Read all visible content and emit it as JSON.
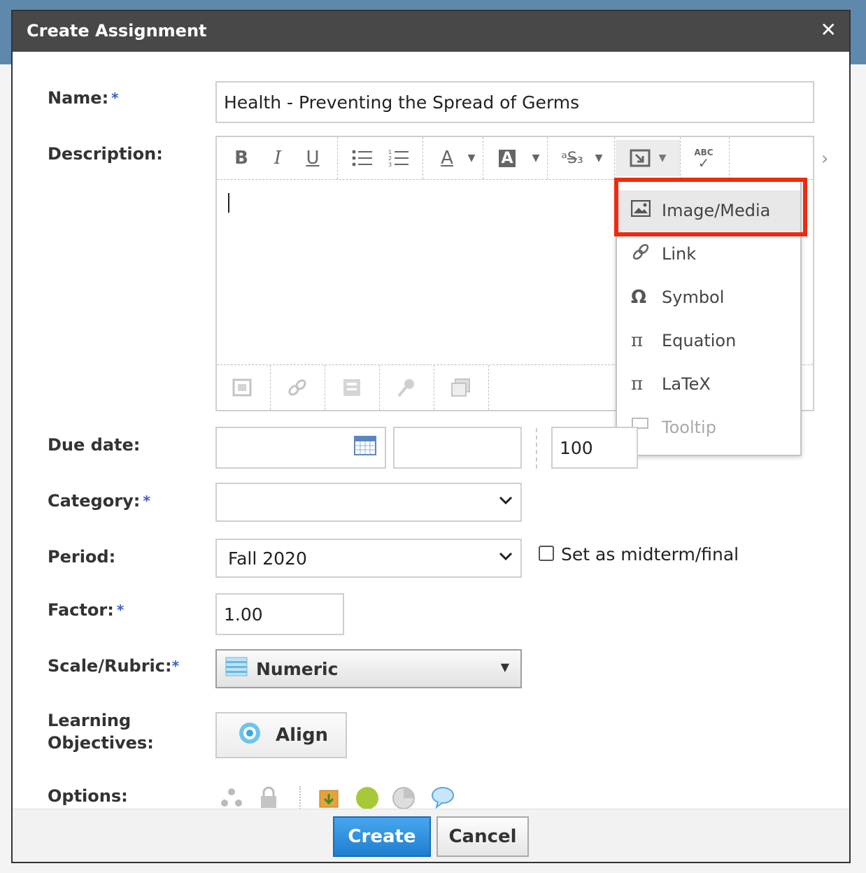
{
  "dialog": {
    "title": "Create Assignment",
    "close_label": "✕"
  },
  "form": {
    "name_label": "Name:",
    "name_value": "Health - Preventing the Spread of Germs",
    "description_label": "Description:",
    "due_date_label": "Due date:",
    "due_points": "100",
    "category_label": "Category:",
    "category_value": "",
    "period_label": "Period:",
    "period_value": "Fall 2020",
    "midterm_label": "Set as midterm/final",
    "factor_label": "Factor:",
    "factor_value": "1.00",
    "scale_label": "Scale/Rubric:",
    "scale_value": "Numeric",
    "objectives_label_line1": "Learning",
    "objectives_label_line2": "Objectives:",
    "align_label": "Align",
    "options_label": "Options:",
    "required_mark": "*"
  },
  "editor_toolbar": {
    "bold": "B",
    "italic": "I",
    "underline": "U",
    "text_color": "A",
    "background_color": "A",
    "spellcheck": "ABC"
  },
  "insert_menu": {
    "items": [
      {
        "label": "Image/Media",
        "icon": "image-icon"
      },
      {
        "label": "Link",
        "icon": "link-icon"
      },
      {
        "label": "Symbol",
        "icon": "omega-icon"
      },
      {
        "label": "Equation",
        "icon": "pi-icon"
      },
      {
        "label": "LaTeX",
        "icon": "pi-icon"
      },
      {
        "label": "Tooltip",
        "icon": "speech-bubble-icon"
      }
    ]
  },
  "footer": {
    "create_label": "Create",
    "cancel_label": "Cancel"
  },
  "colors": {
    "titlebar": "#484848",
    "highlight_box": "#f02a10",
    "create_button": "#2a8ad8",
    "required_star": "#3b5fc0"
  }
}
